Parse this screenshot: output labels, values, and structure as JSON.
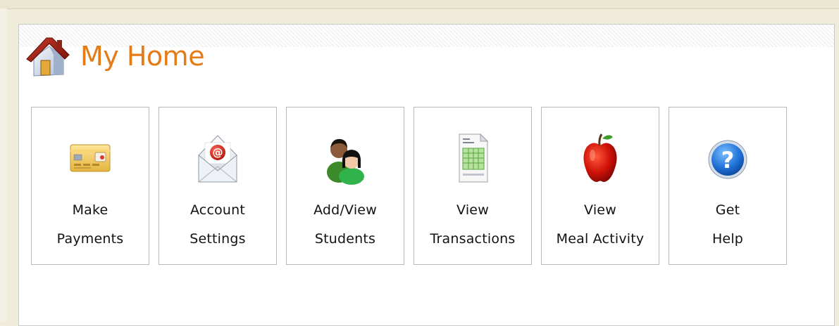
{
  "header": {
    "title": "My Home",
    "icon": "house-icon"
  },
  "tiles": [
    {
      "icon": "credit-card-icon",
      "line1": "Make",
      "line2": "Payments"
    },
    {
      "icon": "email-envelope-icon",
      "line1": "Account",
      "line2": "Settings"
    },
    {
      "icon": "students-icon",
      "line1": "Add/View",
      "line2": "Students"
    },
    {
      "icon": "spreadsheet-document-icon",
      "line1": "View",
      "line2": "Transactions"
    },
    {
      "icon": "apple-icon",
      "line1": "View",
      "line2": "Meal Activity"
    },
    {
      "icon": "help-question-icon",
      "line1": "Get",
      "line2": "Help"
    }
  ],
  "colors": {
    "title": "#e57b17",
    "background": "#efecd9",
    "panel": "#ffffff",
    "tile_border": "#b9b9b9"
  }
}
